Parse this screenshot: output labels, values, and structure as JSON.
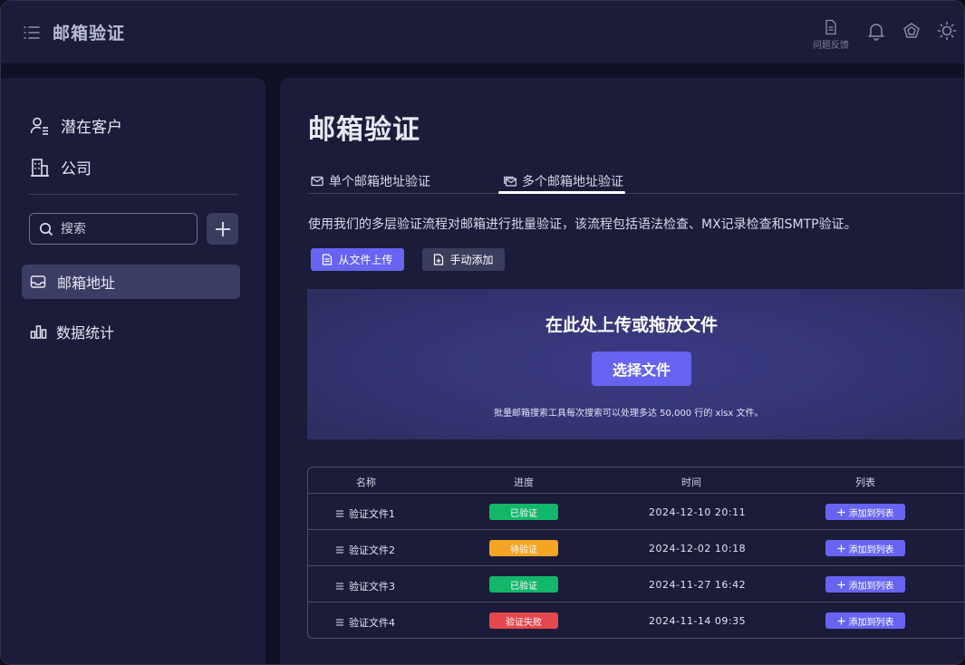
{
  "app": {
    "title": "邮箱验证",
    "menu_icon": "menu-list-icon"
  },
  "topbar": {
    "feedback_label": "问题反馈",
    "icons": [
      "document-icon",
      "bell-icon",
      "gem-icon",
      "sun-icon"
    ]
  },
  "sidebar": {
    "top_items": [
      {
        "label": "潜在客户",
        "icon": "users-icon"
      },
      {
        "label": "公司",
        "icon": "building-icon"
      }
    ],
    "search": {
      "placeholder": "搜索",
      "value": ""
    },
    "nav": [
      {
        "label": "邮箱地址",
        "icon": "inbox-icon",
        "active": true
      },
      {
        "label": "数据统计",
        "icon": "bar-chart-icon",
        "active": false
      }
    ]
  },
  "main": {
    "title": "邮箱验证",
    "tabs": [
      {
        "label": "单个邮箱地址验证",
        "icon": "mail-icon",
        "active": false
      },
      {
        "label": "多个邮箱地址验证",
        "icon": "mails-icon",
        "active": true
      }
    ],
    "description": "使用我们的多层验证流程对邮箱进行批量验证，该流程包括语法检查、MX记录检查和SMTP验证。",
    "buttons": {
      "upload": "从文件上传",
      "manual": "手动添加"
    },
    "dropzone": {
      "title": "在此处上传或拖放文件",
      "choose": "选择文件",
      "note": "批量邮箱搜索工具每次搜索可以处理多达 50,000 行的 xlsx 文件。"
    },
    "table": {
      "headers": [
        "名称",
        "进度",
        "时间",
        "列表"
      ],
      "rows": [
        {
          "name": "验证文件1",
          "status": "已验证",
          "status_color": "#12b76a",
          "time": "2024-12-10 20:11",
          "action": "添加到列表"
        },
        {
          "name": "验证文件2",
          "status": "待验证",
          "status_color": "#f5a524",
          "time": "2024-12-02 10:18",
          "action": "添加到列表"
        },
        {
          "name": "验证文件3",
          "status": "已验证",
          "status_color": "#12b76a",
          "time": "2024-11-27 16:42",
          "action": "添加到列表"
        },
        {
          "name": "验证文件4",
          "status": "验证失败",
          "status_color": "#e5484d",
          "time": "2024-11-14 09:35",
          "action": "添加到列表"
        }
      ]
    }
  },
  "colors": {
    "accent": "#6764f1",
    "panel": "#1b1c3a",
    "background": "#0f1024"
  }
}
